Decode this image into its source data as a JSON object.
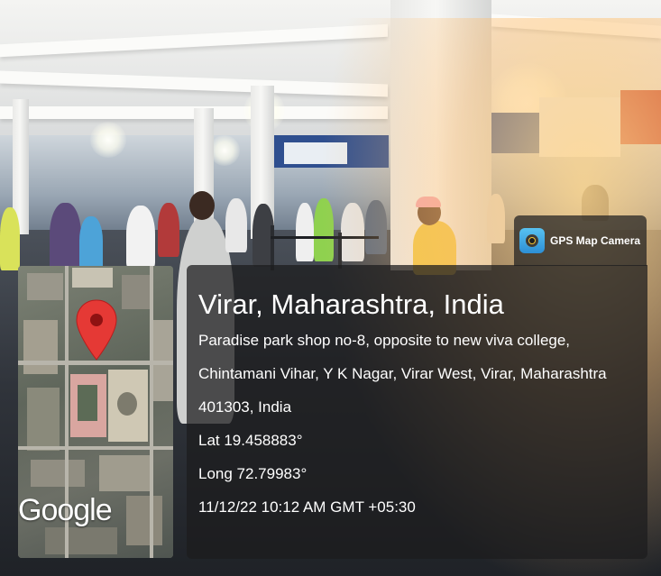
{
  "app_badge": {
    "label": "GPS Map Camera",
    "icon": "gps-map-camera-app-icon"
  },
  "location": {
    "title": "Virar, Maharashtra, India",
    "address_line1": "Paradise park shop no-8, opposite to new viva college,",
    "address_line2": "Chintamani Vihar, Y K Nagar, Virar West, Virar, Maharashtra",
    "address_line3": "401303, India",
    "latitude": "Lat 19.458883°",
    "longitude": "Long 72.79983°",
    "timestamp": "11/12/22 10:12 AM GMT +05:30"
  },
  "map": {
    "provider_label": "Google",
    "marker_icon": "map-pin-icon",
    "marker_color": "#e53935"
  },
  "colors": {
    "overlay": "#1c1c1e",
    "text": "#ffffff"
  }
}
